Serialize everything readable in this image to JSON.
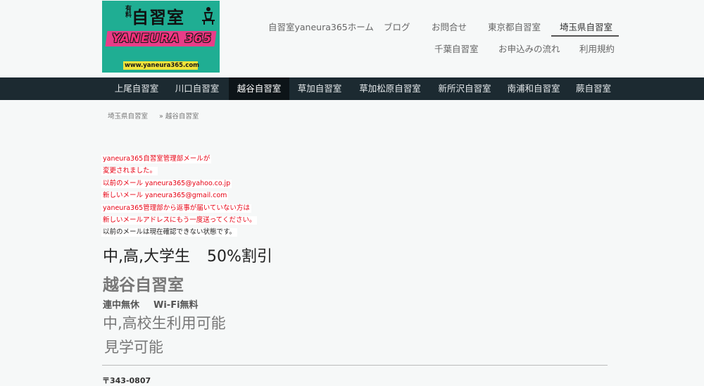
{
  "logo": {
    "small_label": "有料",
    "title": "自習室",
    "brand": "YANEURA 365",
    "url": "www.yaneura365.com"
  },
  "top_nav": [
    {
      "label": "自習室yaneura365ホーム",
      "active": false
    },
    {
      "label": "ブログ",
      "active": false
    },
    {
      "label": "お問合せ",
      "active": false
    },
    {
      "label": "東京都自習室",
      "active": false
    },
    {
      "label": "埼玉県自習室",
      "active": true
    },
    {
      "label": "千葉自習室",
      "active": false
    },
    {
      "label": "お申込みの流れ",
      "active": false
    },
    {
      "label": "利用規約",
      "active": false
    }
  ],
  "category_nav": [
    {
      "label": "上尾自習室",
      "active": false
    },
    {
      "label": "川口自習室",
      "active": false
    },
    {
      "label": "越谷自習室",
      "active": true
    },
    {
      "label": "草加自習室",
      "active": false
    },
    {
      "label": "草加松原自習室",
      "active": false
    },
    {
      "label": "新所沢自習室",
      "active": false
    },
    {
      "label": "南浦和自習室",
      "active": false
    },
    {
      "label": "蕨自習室",
      "active": false
    }
  ],
  "breadcrumb": {
    "parent": "埼玉県自習室",
    "current": "» 越谷自習室"
  },
  "notice": [
    {
      "text": "yaneura365自習室管理部メールが",
      "color": "red"
    },
    {
      "text": "変更されました。",
      "color": "red"
    },
    {
      "text": "以前のメール yaneura365@yahoo.co.jp",
      "color": "red"
    },
    {
      "text": "新しいメール yaneura365@gmail.com",
      "color": "red"
    },
    {
      "text": "yaneura365管理部から返事が届いていない方は",
      "color": "red"
    },
    {
      "text": "新しいメールアドレスにもう一度送ってください。",
      "color": "red"
    },
    {
      "text": "以前のメールは現在確認できない状態です。",
      "color": "dark"
    }
  ],
  "content": {
    "promo_label": "中,高,大学生",
    "promo_discount": "50%割引",
    "heading": "越谷自習室",
    "features_a": "連中無休",
    "features_b": "Wi-Fi無料",
    "line1": "中,高校生利用可能",
    "line2": "見学可能",
    "postal": "〒343-0807"
  },
  "colors": {
    "page_bg": "#f6f8f8",
    "category_bar": "#1c2a31",
    "notice_red": "#e60012",
    "logo_teal": "#1fae93",
    "logo_pink": "#e83d88"
  }
}
